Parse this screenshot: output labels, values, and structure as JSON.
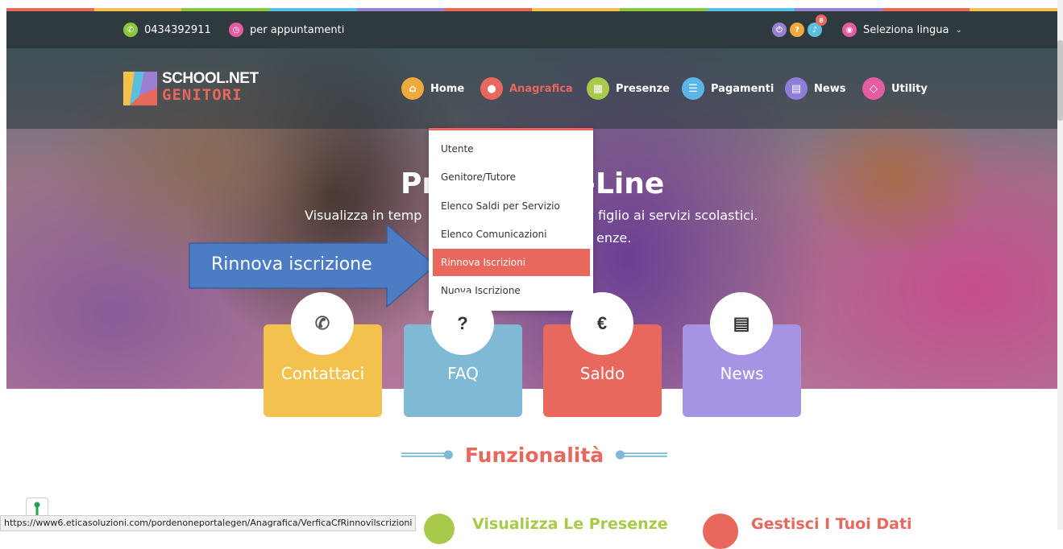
{
  "colors": {
    "rainbow": [
      "#e8685e",
      "#f2c14e",
      "#8ac73f",
      "#5bc0de",
      "#9b7fd4",
      "#e8685e",
      "#f2c14e",
      "#8ac73f",
      "#5bc0de",
      "#9b7fd4",
      "#e8685e",
      "#f2c14e"
    ],
    "topbar_bg": "#2f3a3e",
    "accent_red": "#e8685e",
    "yellow": "#f2c14e",
    "blue": "#7fb9d4",
    "purple": "#a793e3",
    "callout_blue": "#4c7dc4"
  },
  "topbar": {
    "phone": "0434392911",
    "appointments": "per appuntamenti",
    "notifications_count": "8",
    "language": "Seleziona lingua"
  },
  "logo": {
    "line1": "SCHOOL.NET",
    "line2": "GENITORI"
  },
  "nav": [
    {
      "label": "Home",
      "icon": "home-icon",
      "color": "#f2a93b"
    },
    {
      "label": "Anagrafica",
      "icon": "user-icon",
      "color": "#e8685e"
    },
    {
      "label": "Presenze",
      "icon": "calendar-icon",
      "color": "#a8c94a"
    },
    {
      "label": "Pagamenti",
      "icon": "list-icon",
      "color": "#5bb6e6"
    },
    {
      "label": "News",
      "icon": "newspaper-icon",
      "color": "#8f7ed8"
    },
    {
      "label": "Utility",
      "icon": "code-icon",
      "color": "#e65ca0"
    }
  ],
  "hero": {
    "title": "Pr",
    "title_right": "-Line",
    "sub_left": "Visualizza in temp",
    "sub_right": "figlio ai servizi scolastici.",
    "sub2": "enze."
  },
  "dropdown": [
    "Utente",
    "Genitore/Tutore",
    "Elenco Saldi per Servizio",
    "Elenco Comunicazioni",
    "Rinnova Iscrizioni",
    "Nuova Iscrizione"
  ],
  "callout": "Rinnova iscrizione",
  "cards": [
    {
      "label": "Contattaci",
      "icon": "phone-icon",
      "glyph": "✆",
      "color": "#f2c14e"
    },
    {
      "label": "FAQ",
      "icon": "question-icon",
      "glyph": "?",
      "color": "#7fb9d4"
    },
    {
      "label": "Saldo",
      "icon": "euro-icon",
      "glyph": "€",
      "color": "#e8685e"
    },
    {
      "label": "News",
      "icon": "newspaper-icon",
      "glyph": "▤",
      "color": "#a793e3"
    }
  ],
  "funzionalita": "Funzionalità",
  "features": {
    "presenze": "Visualizza Le Presenze",
    "dati": "Gestisci I Tuoi Dati"
  },
  "status_url": "https://www6.eticasoluzioni.com/pordenoneportalegen/Anagrafica/VerficaCfRinnovilscrizioni"
}
